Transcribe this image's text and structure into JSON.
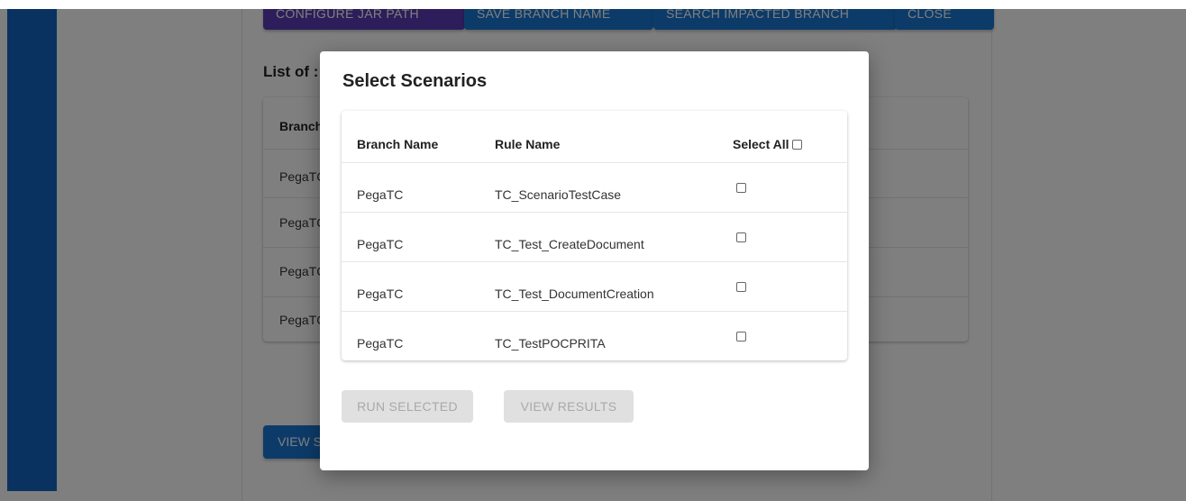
{
  "background": {
    "buttons": {
      "configure_jar": "CONFIGURE JAR PATH",
      "save_branch": "SAVE BRANCH NAME",
      "search_impacted": "SEARCH IMPACTED BRANCH",
      "close": "CLOSE"
    },
    "list_title": "List of :",
    "table_header": "Branch",
    "rows": [
      "PegaTC",
      "PegaTC",
      "PegaTC",
      "PegaTC"
    ],
    "view_button": "VIEW S"
  },
  "modal": {
    "title": "Select Scenarios",
    "columns": {
      "branch": "Branch Name",
      "rule": "Rule Name",
      "select_all": "Select All"
    },
    "rows": [
      {
        "branch": "PegaTC",
        "rule": "TC_ScenarioTestCase",
        "selected": false
      },
      {
        "branch": "PegaTC",
        "rule": "TC_Test_CreateDocument",
        "selected": false
      },
      {
        "branch": "PegaTC",
        "rule": "TC_Test_DocumentCreation",
        "selected": false
      },
      {
        "branch": "PegaTC",
        "rule": "TC_TestPOCPRITA",
        "selected": false
      }
    ],
    "buttons": {
      "run_selected": "RUN SELECTED",
      "view_results": "VIEW RESULTS"
    }
  },
  "colors": {
    "sidebar": "#1565c0",
    "primary": "#1976d2",
    "configure_button": "#5b3bb5",
    "disabled_bg": "#e0e0e0",
    "disabled_text": "#a9a9a9"
  }
}
